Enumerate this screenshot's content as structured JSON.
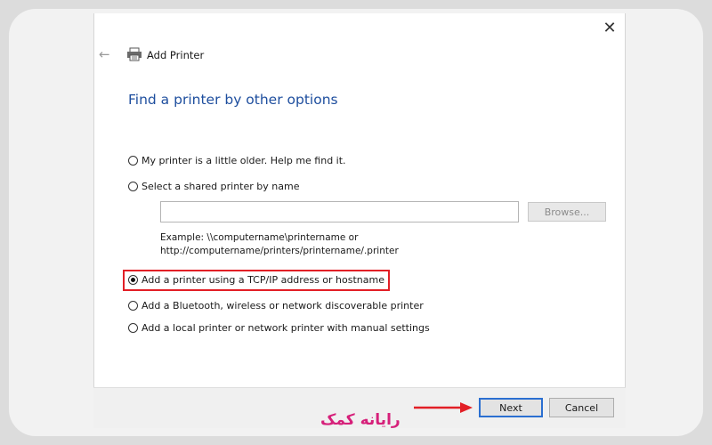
{
  "window": {
    "title": "Add Printer",
    "close_glyph": "✕",
    "back_glyph": "←"
  },
  "heading": "Find a printer by other options",
  "options": [
    {
      "label": "My printer is a little older. Help me find it.",
      "checked": false
    },
    {
      "label": "Select a shared printer by name",
      "checked": false
    },
    {
      "label": "Add a printer using a TCP/IP address or hostname",
      "checked": true
    },
    {
      "label": "Add a Bluetooth, wireless or network discoverable printer",
      "checked": false
    },
    {
      "label": "Add a local printer or network printer with manual settings",
      "checked": false
    }
  ],
  "shared_printer": {
    "value": "",
    "browse_label": "Browse...",
    "example_line1": "Example: \\\\computername\\printername or",
    "example_line2": "http://computername/printers/printername/.printer"
  },
  "buttons": {
    "next": "Next",
    "cancel": "Cancel"
  },
  "watermark": {
    "logo_text": "رایانه کمک"
  },
  "colors": {
    "heading": "#1e4e9e",
    "highlight": "#e21f26",
    "logo": "#d6207a",
    "next_border": "#2b6fd1"
  },
  "icons": {
    "printer": "printer-icon",
    "back": "back-arrow-icon",
    "close": "close-icon",
    "pointer": "red-arrow-icon"
  }
}
